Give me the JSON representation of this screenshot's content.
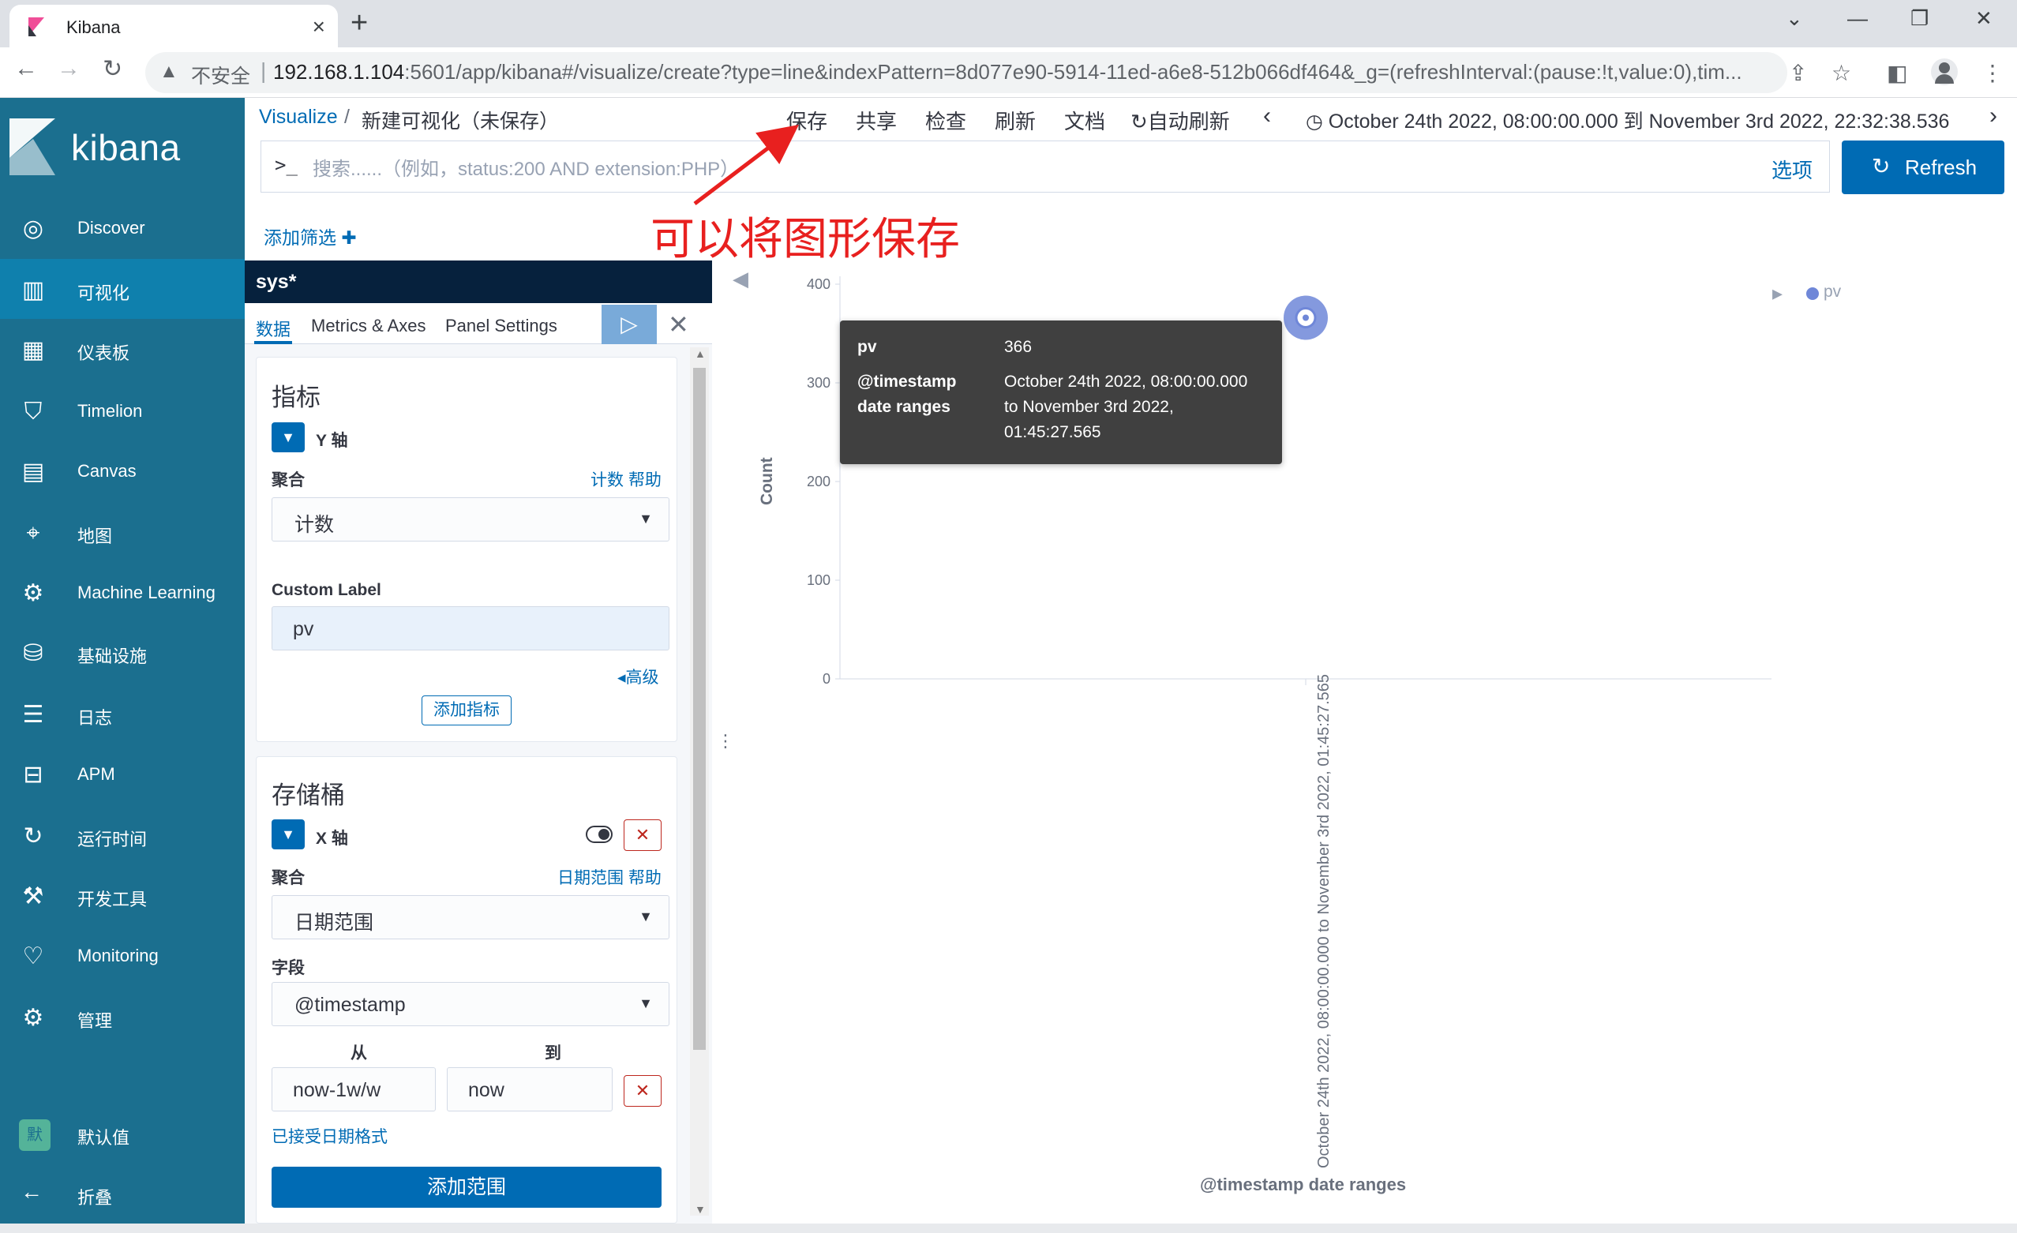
{
  "browser": {
    "tab_title": "Kibana",
    "tab_close": "×",
    "new_tab": "+",
    "security_warning": "不安全",
    "url_host": "192.168.1.104",
    "url_rest": ":5601/app/kibana#/visualize/create?type=line&indexPattern=8d077e90-5914-11ed-a6e8-512b066df464&_g=(refreshInterval:(pause:!t,value:0),tim...",
    "window_controls": [
      "⌄",
      "—",
      "❐",
      "✕"
    ]
  },
  "sidebar": {
    "logo_text": "kibana",
    "items": [
      {
        "label": "Discover",
        "icon": "compass-icon",
        "glyph": "◎"
      },
      {
        "label": "可视化",
        "icon": "visualize-icon",
        "glyph": "▥"
      },
      {
        "label": "仪表板",
        "icon": "dashboard-icon",
        "glyph": "▦"
      },
      {
        "label": "Timelion",
        "icon": "timelion-icon",
        "glyph": "⛉"
      },
      {
        "label": "Canvas",
        "icon": "canvas-icon",
        "glyph": "▤"
      },
      {
        "label": "地图",
        "icon": "map-icon",
        "glyph": "⌖"
      },
      {
        "label": "Machine Learning",
        "icon": "ml-icon",
        "glyph": "⚙"
      },
      {
        "label": "基础设施",
        "icon": "infrastructure-icon",
        "glyph": "⛁"
      },
      {
        "label": "日志",
        "icon": "logs-icon",
        "glyph": "☰"
      },
      {
        "label": "APM",
        "icon": "apm-icon",
        "glyph": "⊟"
      },
      {
        "label": "运行时间",
        "icon": "uptime-icon",
        "glyph": "↻"
      },
      {
        "label": "开发工具",
        "icon": "devtools-icon",
        "glyph": "⚒"
      },
      {
        "label": "Monitoring",
        "icon": "monitoring-icon",
        "glyph": "♡"
      },
      {
        "label": "管理",
        "icon": "gear-icon",
        "glyph": "⚙"
      }
    ],
    "default_space_badge": "默",
    "default_space_label": "默认值",
    "collapse_label": "折叠",
    "collapse_glyph": "←"
  },
  "toolbar": {
    "breadcrumb_link": "Visualize",
    "breadcrumb_sep": "/",
    "breadcrumb_title": "新建可视化（未保存）",
    "save": "保存",
    "share": "共享",
    "inspect": "检查",
    "refresh": "刷新",
    "docs": "文档",
    "auto_refresh": "自动刷新",
    "time_range": "October 24th 2022, 08:00:00.000 到 November 3rd 2022, 22:32:38.536",
    "query_prompt": ">_",
    "query_placeholder": "搜索......（例如，status:200 AND extension:PHP）",
    "options": "选项",
    "refresh_button": "Refresh",
    "add_filter": "添加筛选"
  },
  "annotation": {
    "text": "可以将图形保存",
    "color": "#e8201f"
  },
  "editor": {
    "index_pattern": "sys*",
    "tabs": [
      "数据",
      "Metrics & Axes",
      "Panel Settings"
    ],
    "metrics": {
      "section_title": "指标",
      "agg_title": "Y 轴",
      "agg_label": "聚合",
      "help": "计数 帮助",
      "agg_value": "计数",
      "custom_label_title": "Custom Label",
      "custom_label_value": "pv",
      "advanced": "高级",
      "add_metric": "添加指标"
    },
    "buckets": {
      "section_title": "存储桶",
      "agg_title": "X 轴",
      "agg_label": "聚合",
      "help": "日期范围 帮助",
      "agg_value": "日期范围",
      "field_label": "字段",
      "field_value": "@timestamp",
      "from_label": "从",
      "to_label": "到",
      "from_value": "now-1w/w",
      "to_value": "now",
      "accepted_formats": "已接受日期格式",
      "add_range": "添加范围"
    }
  },
  "chart_data": {
    "type": "line",
    "categories": [
      "October 24th 2022, 08:00:00.000 to November 3rd 2022, 01:45:27.565"
    ],
    "series": [
      {
        "name": "pv",
        "values": [
          366
        ],
        "color": "#6f87d8"
      }
    ],
    "xlabel": "@timestamp date ranges",
    "ylabel": "Count",
    "ylim": [
      0,
      400
    ],
    "yticks": [
      0,
      100,
      200,
      300,
      400
    ],
    "legend": "top-right",
    "grid": false,
    "tooltip": {
      "series_key": "pv",
      "series_value": "366",
      "x_key_line1": "@timestamp",
      "x_key_line2": "date ranges",
      "x_value_line1": "October 24th 2022, 08:00:00.000",
      "x_value_line2": "to November 3rd 2022,",
      "x_value_line3": "01:45:27.565"
    }
  }
}
